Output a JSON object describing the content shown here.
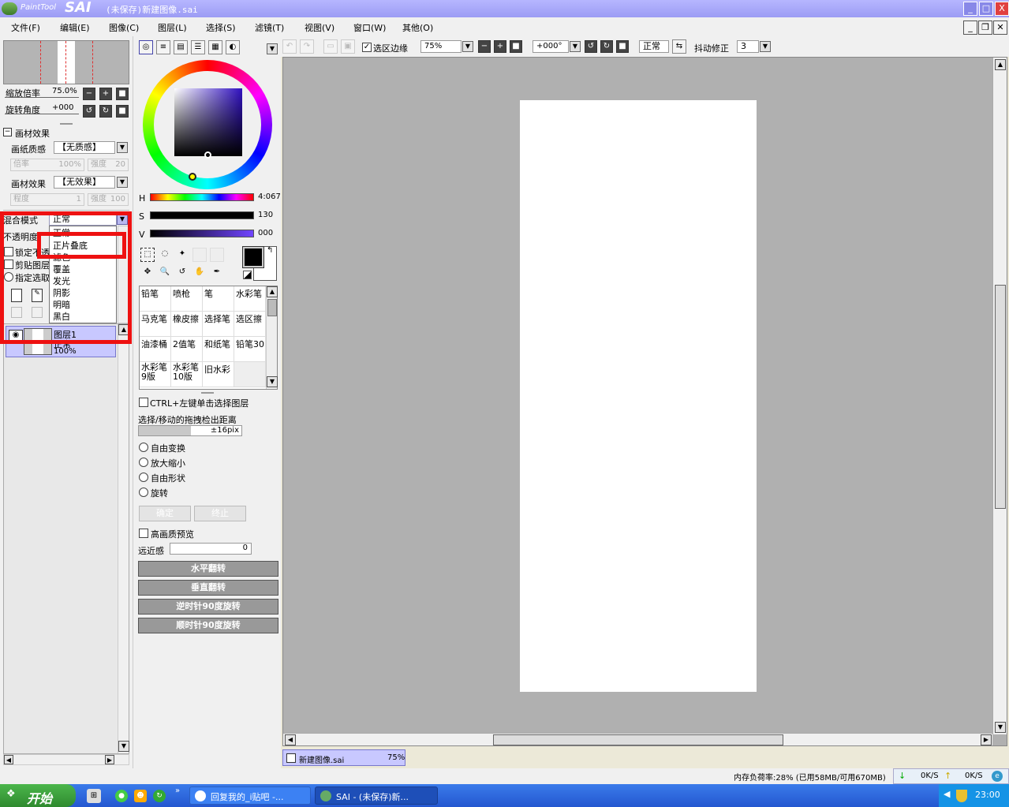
{
  "window": {
    "title": "(未保存)新建图像.sai",
    "logo_small": "PaintTool",
    "logo_big": "SAI",
    "min_label": "_",
    "max_label": "□",
    "close_label": "X"
  },
  "menu": [
    "文件(F)",
    "编辑(E)",
    "图像(C)",
    "图层(L)",
    "选择(S)",
    "滤镜(T)",
    "视图(V)",
    "窗口(W)",
    "其他(O)"
  ],
  "navigator": {
    "zoom_label": "缩放倍率",
    "zoom_value": "75.0%",
    "rotate_label": "旋转角度",
    "rotate_value": "+000"
  },
  "material": {
    "section_title": "画材效果",
    "paper_label": "画纸质感",
    "paper_value": "【无质感】",
    "rate_label": "倍率",
    "rate_value": "100%",
    "strength_label": "强度",
    "strength_value": "20",
    "effect_label": "画材效果",
    "effect_value": "【无效果】",
    "degree_label": "程度",
    "degree_value": "1",
    "strength2_label": "强度",
    "strength2_value": "100"
  },
  "layer_panel": {
    "blend_label": "混合模式",
    "blend_value": "正常",
    "opacity_label": "不透明度",
    "lock_label": "锁定不透",
    "clip_label": "剪贴图层",
    "select_label": "指定选取",
    "blend_options": [
      "正常",
      "正片叠底",
      "滤色",
      "覆盖",
      "发光",
      "阴影",
      "明暗",
      "黑白"
    ],
    "layer_name": "图层1",
    "layer_mode": "正常",
    "layer_opacity": "100%"
  },
  "color": {
    "h_label": "H",
    "h_value": "4:067",
    "s_label": "S",
    "s_value": "130",
    "v_label": "V",
    "v_value": "000",
    "fg_color": "#000000",
    "bg_color": "#ffffff"
  },
  "brushes": [
    {
      "name": "铅笔"
    },
    {
      "name": "喷枪"
    },
    {
      "name": "笔"
    },
    {
      "name": "水彩笔"
    },
    {
      "name": "马克笔"
    },
    {
      "name": "橡皮擦"
    },
    {
      "name": "选择笔"
    },
    {
      "name": "选区擦"
    },
    {
      "name": "油漆桶"
    },
    {
      "name": "2值笔"
    },
    {
      "name": "和纸笔"
    },
    {
      "name": "铅笔30"
    },
    {
      "name": "水彩笔9版"
    },
    {
      "name": "水彩笔10版"
    },
    {
      "name": "旧水彩"
    },
    {
      "name": ""
    }
  ],
  "transform": {
    "ctrl_label": "CTRL+左键单击选择图层",
    "distance_label": "选择/移动的拖拽检出距离",
    "distance_value": "±16pix",
    "free_transform": "自由变换",
    "scale": "放大缩小",
    "free_shape": "自由形状",
    "rotate": "旋转",
    "confirm": "确定",
    "cancel": "终止",
    "hq_preview": "高画质预览",
    "perspective_label": "远近感",
    "perspective_value": "0",
    "flip_h": "水平翻转",
    "flip_v": "垂直翻转",
    "rot_ccw": "逆时针90度旋转",
    "rot_cw": "顺时针90度旋转"
  },
  "toolbar": {
    "selection_edge": "选区边缘",
    "zoom": "75%",
    "angle": "+000°",
    "mode": "正常",
    "stabilizer_label": "抖动修正",
    "stabilizer_value": "3"
  },
  "canvas_tab": {
    "name": "新建图像.sai",
    "zoom": "75%"
  },
  "status": {
    "memory": "内存负荷率:28% (已用58MB/可用670MB)",
    "down": "0K/S",
    "up": "0K/S"
  },
  "taskbar": {
    "start": "开始",
    "task1": "回复我的_i贴吧 -...",
    "task2": "SAI - (未保存)新...",
    "clock": "23:00",
    "chevron": "»"
  }
}
